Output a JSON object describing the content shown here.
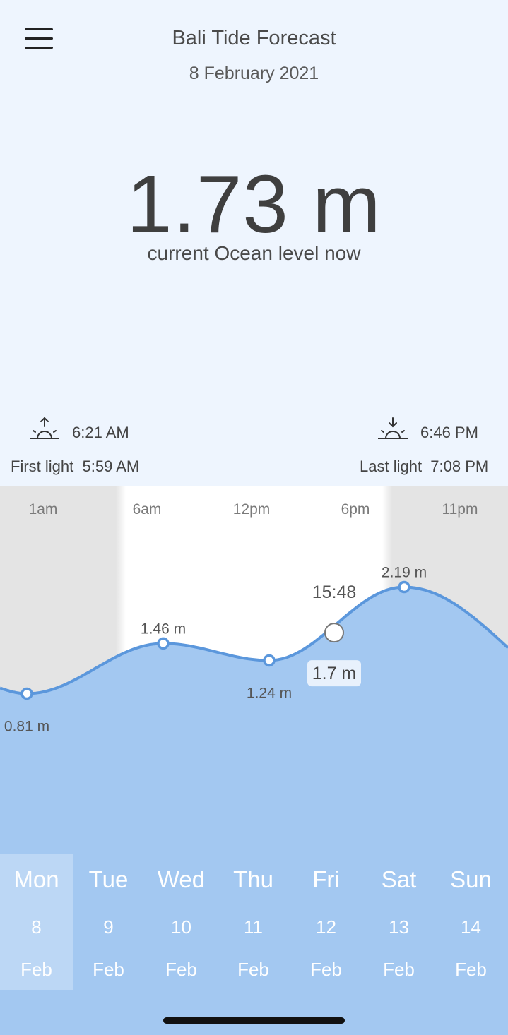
{
  "header": {
    "title": "Bali Tide Forecast",
    "date": "8 February 2021"
  },
  "current": {
    "level": "1.73 m",
    "caption": "current Ocean level now"
  },
  "sun": {
    "sunrise": "6:21 AM",
    "sunset": "6:46 PM",
    "first_light_label": "First light",
    "first_light": "5:59 AM",
    "last_light_label": "Last light",
    "last_light": "7:08 PM"
  },
  "chart_data": {
    "type": "area",
    "x_tick_labels": [
      "1am",
      "6am",
      "12pm",
      "6pm",
      "11pm"
    ],
    "extremes": [
      {
        "time": "~0am",
        "value": 0.81,
        "label": "0.81 m"
      },
      {
        "time": "~7am",
        "value": 1.46,
        "label": "1.46 m"
      },
      {
        "time": "~12pm",
        "value": 1.24,
        "label": "1.24 m"
      },
      {
        "time": "~7pm",
        "value": 2.19,
        "label": "2.19 m"
      }
    ],
    "cursor": {
      "time": "15:48",
      "value": 1.7,
      "label": "1.7 m"
    },
    "colors": {
      "area": "#a3c8f1",
      "line": "#5b97dc",
      "night": "#e4e4e4",
      "day": "#ffffff"
    }
  },
  "days": [
    {
      "name": "Mon",
      "num": "8",
      "month": "Feb",
      "selected": true
    },
    {
      "name": "Tue",
      "num": "9",
      "month": "Feb"
    },
    {
      "name": "Wed",
      "num": "10",
      "month": "Feb"
    },
    {
      "name": "Thu",
      "num": "11",
      "month": "Feb"
    },
    {
      "name": "Fri",
      "num": "12",
      "month": "Feb"
    },
    {
      "name": "Sat",
      "num": "13",
      "month": "Feb"
    },
    {
      "name": "Sun",
      "num": "14",
      "month": "Feb"
    }
  ]
}
